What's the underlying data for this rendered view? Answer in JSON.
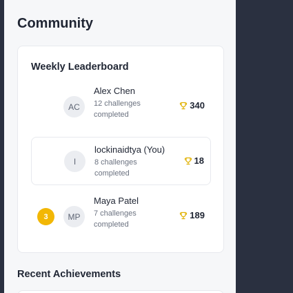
{
  "community": {
    "title": "Community"
  },
  "leaderboard": {
    "title": "Weekly Leaderboard",
    "entries": [
      {
        "rank": "",
        "initials": "AC",
        "name": "Alex Chen",
        "challenges": "12 challenges completed",
        "score": "340",
        "is_you": false
      },
      {
        "rank": "",
        "initials": "I",
        "name": "lockinaidtya (You)",
        "challenges": "8 challenges completed",
        "score": "18",
        "is_you": true
      },
      {
        "rank": "3",
        "initials": "MP",
        "name": "Maya Patel",
        "challenges": "7 challenges completed",
        "score": "189",
        "is_you": false
      }
    ]
  },
  "achievements": {
    "title": "Recent Achievements"
  },
  "colors": {
    "trophy": "#e0b000",
    "rank_badge": "#f2b705",
    "sidebar_dark": "#2a3040"
  },
  "icons": {
    "trophy": "trophy-icon"
  }
}
